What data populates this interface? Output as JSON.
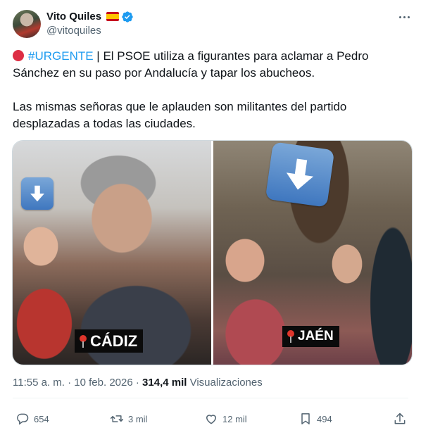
{
  "author": {
    "display_name": "Vito Quiles",
    "handle": "@vitoquiles",
    "flag": "spain-flag-icon",
    "verified": true
  },
  "post": {
    "hashtag": "#URGENTE",
    "line1_rest": " | El PSOE utiliza a figurantes para aclamar a Pedro Sánchez en su paso por Andalucía y tapar los abucheos.",
    "line2": "Las mismas señoras que le aplauden son militantes del partido desplazadas a todas las ciudades."
  },
  "media": {
    "left_label": "CÁDIZ",
    "right_label": "JAÉN"
  },
  "meta": {
    "time": "11:55 a. m.",
    "separator": " · ",
    "date": "10 feb. 2026",
    "views_count": "314,4 mil",
    "views_label": " Visualizaciones"
  },
  "actions": {
    "replies": "654",
    "reposts": "3 mil",
    "likes": "12 mil",
    "bookmarks": "494"
  },
  "colors": {
    "accent": "#1d9bf0",
    "text": "#0f1419",
    "muted": "#536471",
    "urgent_dot": "#dd2e44"
  }
}
